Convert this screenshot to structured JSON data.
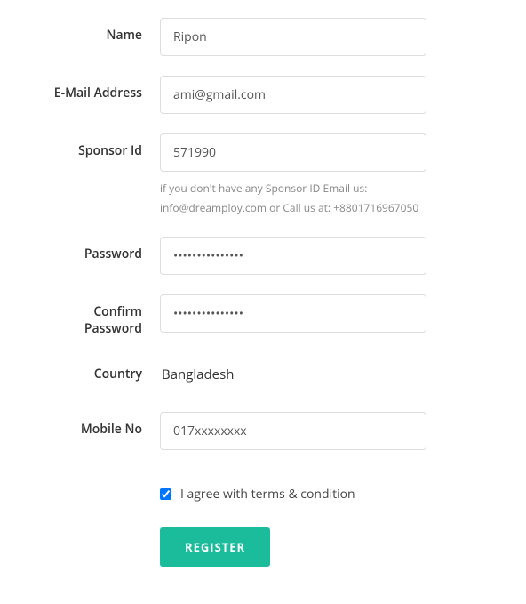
{
  "form": {
    "name": {
      "label": "Name",
      "value": "Ripon"
    },
    "email": {
      "label": "E-Mail Address",
      "value": "ami@gmail.com"
    },
    "sponsor": {
      "label": "Sponsor Id",
      "value": "571990",
      "help": "if you don't have any Sponsor ID Email us: info@dreamploy.com or Call us at: +8801716967050"
    },
    "password": {
      "label": "Password",
      "value": "•••••••••••••••"
    },
    "confirm_password": {
      "label": "Confirm Password",
      "value": "•••••••••••••••"
    },
    "country": {
      "label": "Country",
      "value": "Bangladesh"
    },
    "mobile": {
      "label": "Mobile No",
      "value": "017xxxxxxxx"
    },
    "terms": {
      "label": "I agree with terms & condition",
      "checked": true
    },
    "submit": {
      "label": "REGISTER"
    }
  }
}
